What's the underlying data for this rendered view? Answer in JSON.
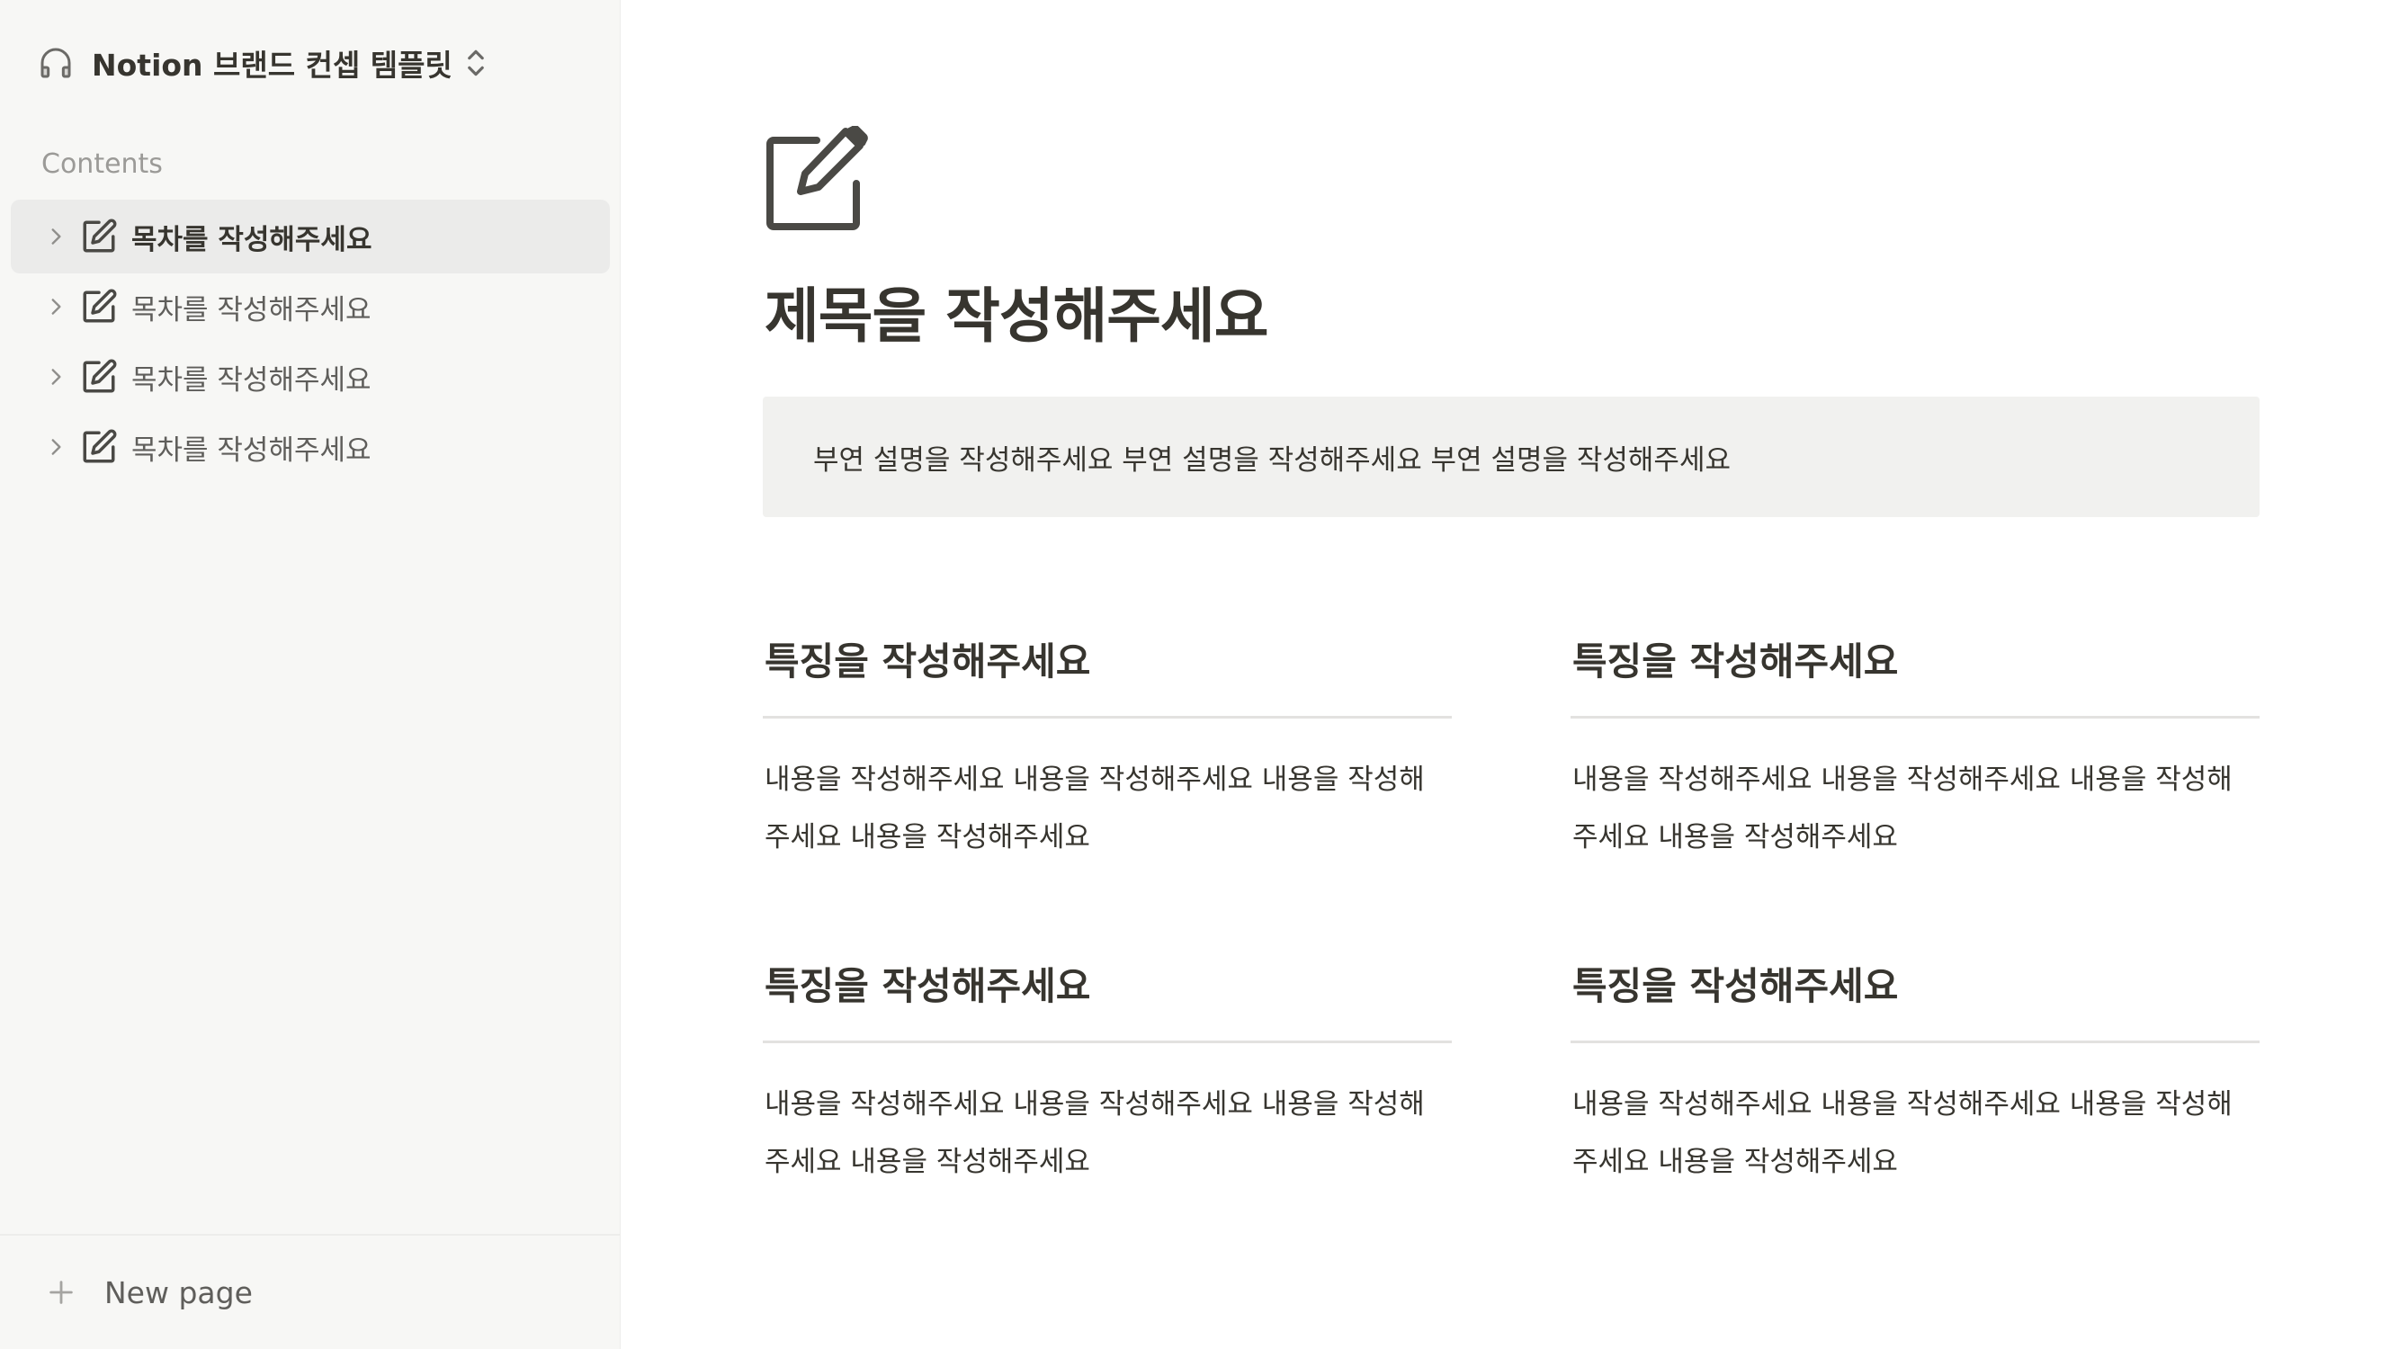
{
  "workspace": {
    "name": "Notion 브랜드 컨셉 템플릿",
    "icon": "headphones-icon"
  },
  "sidebar": {
    "section_label": "Contents",
    "items": [
      {
        "label": "목차를 작성해주세요",
        "active": true
      },
      {
        "label": "목차를 작성해주세요",
        "active": false
      },
      {
        "label": "목차를 작성해주세요",
        "active": false
      },
      {
        "label": "목차를 작성해주세요",
        "active": false
      }
    ],
    "new_page_label": "New page"
  },
  "page": {
    "icon": "edit-note-icon",
    "title": "제목을 작성해주세요",
    "callout": "부연 설명을 작성해주세요 부연 설명을 작성해주세요 부연 설명을 작성해주세요",
    "features": [
      {
        "heading": "특징을 작성해주세요",
        "body": "내용을 작성해주세요 내용을 작성해주세요 내용을 작성해주세요 내용을 작성해주세요"
      },
      {
        "heading": "특징을 작성해주세요",
        "body": "내용을 작성해주세요 내용을 작성해주세요 내용을 작성해주세요 내용을 작성해주세요"
      },
      {
        "heading": "특징을 작성해주세요",
        "body": "내용을 작성해주세요 내용을 작성해주세요 내용을 작성해주세요 내용을 작성해주세요"
      },
      {
        "heading": "특징을 작성해주세요",
        "body": "내용을 작성해주세요 내용을 작성해주세요 내용을 작성해주세요 내용을 작성해주세요"
      }
    ]
  },
  "colors": {
    "sidebar_bg": "#f7f7f5",
    "active_item_bg": "#ebebea",
    "callout_bg": "#f1f1ef",
    "text": "#37352f",
    "muted_text": "#9b9a97"
  }
}
